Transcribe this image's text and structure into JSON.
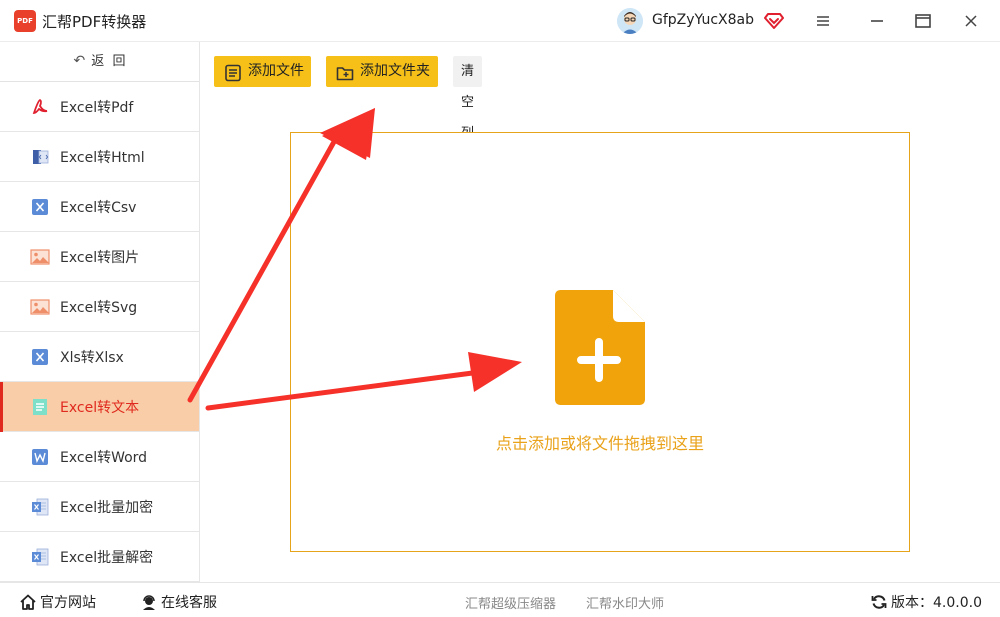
{
  "app": {
    "title": "汇帮PDF转换器",
    "logo_text": "PDF"
  },
  "user": {
    "name": "GfpZyYucX8ab"
  },
  "colors": {
    "accent": "#f6c019",
    "active_bg": "#f8cda7",
    "active_text": "#e02a1f",
    "drop_border": "#e5a41a"
  },
  "sidebar": {
    "back_label": "返  回",
    "items": [
      {
        "label": "Excel转Pdf",
        "icon": "pdf-icon"
      },
      {
        "label": "Excel转Html",
        "icon": "html-icon"
      },
      {
        "label": "Excel转Csv",
        "icon": "excel-icon"
      },
      {
        "label": "Excel转图片",
        "icon": "image-icon"
      },
      {
        "label": "Excel转Svg",
        "icon": "image-icon"
      },
      {
        "label": "Xls转Xlsx",
        "icon": "excel-icon"
      },
      {
        "label": "Excel转文本",
        "icon": "text-icon",
        "active": true
      },
      {
        "label": "Excel转Word",
        "icon": "word-icon"
      },
      {
        "label": "Excel批量加密",
        "icon": "excel-file-icon"
      },
      {
        "label": "Excel批量解密",
        "icon": "excel-file-icon"
      }
    ]
  },
  "toolbar": {
    "add_file": "添加文件",
    "add_folder": "添加文件夹",
    "clear_list": "清空列表"
  },
  "dropzone": {
    "hint": "点击添加或将文件拖拽到这里"
  },
  "footer": {
    "website": "官方网站",
    "support": "在线客服",
    "link1": "汇帮超级压缩器",
    "link2": "汇帮水印大师",
    "version": "版本：4.0.0.0"
  }
}
